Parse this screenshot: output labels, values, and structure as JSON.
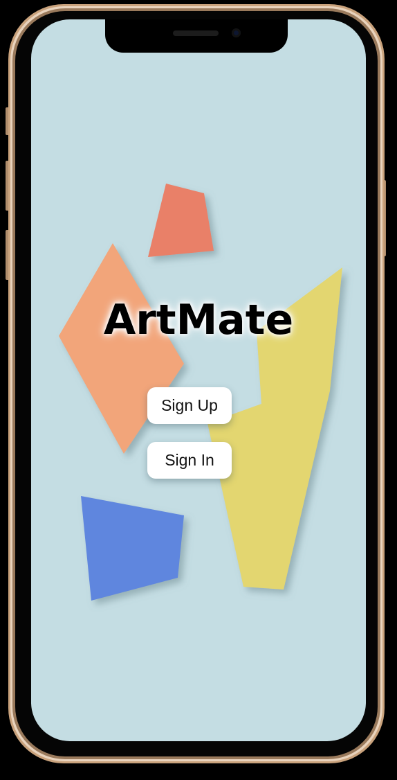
{
  "app": {
    "title": "ArtMate"
  },
  "actions": {
    "sign_up_label": "Sign Up",
    "sign_in_label": "Sign In"
  },
  "colors": {
    "background": "#c4dde3",
    "shape_coral": "#e98068",
    "shape_peach": "#f2a57a",
    "shape_yellow": "#e3d670",
    "shape_blue": "#5f86de",
    "frame_gold": "#c9a27c"
  }
}
